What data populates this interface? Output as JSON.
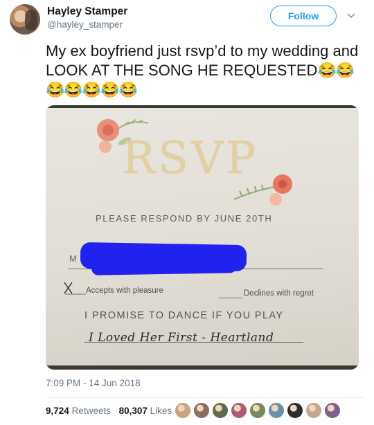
{
  "author": {
    "display_name": "Hayley Stamper",
    "handle": "@hayley_stamper"
  },
  "follow_label": "Follow",
  "tweet": {
    "text": "My ex boyfriend just rsvp’d to my wedding and LOOK AT THE SONG HE REQUESTED",
    "emojis": "😂😂😂😂😂😂😂"
  },
  "media": {
    "title": "RSVP",
    "respond_line": "PLEASE RESPOND BY JUNE 20TH",
    "name_prefix": "M",
    "accepts": "Accepts with pleasure",
    "declines": "Declines with regret",
    "promise": "I PROMISE TO DANCE IF YOU PLAY",
    "song": "I Loved Her First - Heartland"
  },
  "timestamp": "7:09 PM - 14 Jun 2018",
  "stats": {
    "retweets_count": "9,724",
    "retweets_label": "Retweets",
    "likes_count": "80,307",
    "likes_label": "Likes"
  },
  "liker_colors": [
    "#c9a27e",
    "#8a6d5a",
    "#5d6b4a",
    "#b05b73",
    "#7a8a55",
    "#6b8fa8",
    "#2c2c2c",
    "#c6a78c",
    "#7e5f8f"
  ],
  "colors": {
    "accent": "#1da1f2",
    "text": "#14171a",
    "secondary": "#657786",
    "redaction": "#2222ee"
  }
}
